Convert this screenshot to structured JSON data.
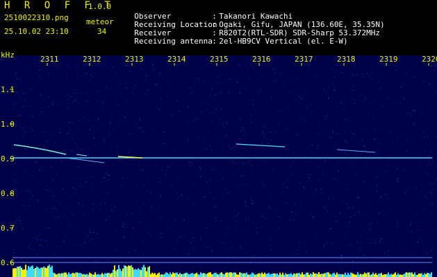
{
  "app": {
    "title": "H R O F F T",
    "version": "1.0.0"
  },
  "file": {
    "name": "2510022310.png",
    "timestamp": "25.10.02 23:10"
  },
  "meteor": {
    "label": "meteor",
    "count": "34"
  },
  "station_info": [
    {
      "key": "Observer",
      "value": "Takanori Kawachi"
    },
    {
      "key": "Receiving Location",
      "value": "Ogaki, Gifu, JAPAN (136.60E, 35.35N)"
    },
    {
      "key": "Receiver",
      "value": "R820T2(RTL-SDR) SDR-Sharp 53.372MHz"
    },
    {
      "key": "Receiving antenna",
      "value": "2el-HB9CV Vertical (el. E-W)"
    }
  ],
  "axes": {
    "y_unit": "kHz",
    "y_ticks": [
      "1.1",
      "1.0",
      "0.9",
      "0.8",
      "0.7",
      "0.6"
    ],
    "x_ticks": [
      "2311",
      "2312",
      "2313",
      "2314",
      "2315",
      "2316",
      "2317",
      "2318",
      "2319",
      "2320"
    ]
  },
  "colors": {
    "background": "#000000",
    "noise": "#000060",
    "axis_labels": "#f2f200",
    "carrier": "#4fd0ff",
    "histogram": "#f2f200"
  }
}
